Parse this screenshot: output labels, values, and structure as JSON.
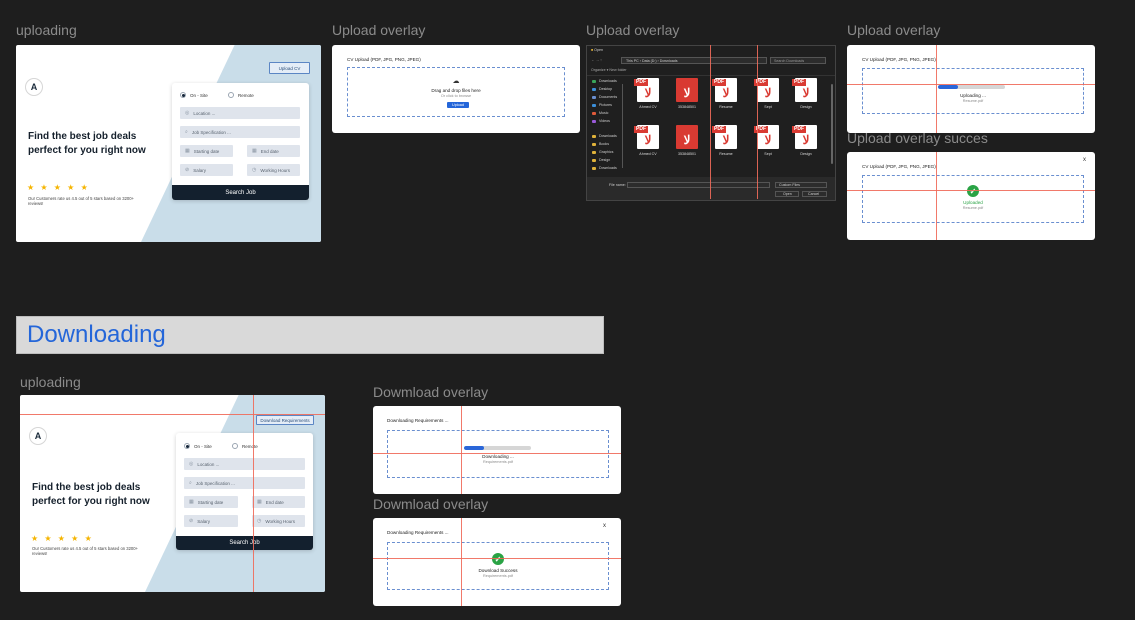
{
  "labels": {
    "uploading_top": "uploading",
    "upload_overlay_1": "Upload overlay",
    "upload_overlay_2": "Upload overlay",
    "upload_overlay_3": "Upload overlay",
    "upload_overlay_success": "Upload overlay succes",
    "uploading_bottom": "uploading",
    "download_overlay_1": "Dowmload overlay",
    "download_overlay_2": "Dowmload overlay"
  },
  "section": {
    "title": "Downloading"
  },
  "landing": {
    "logo": "A",
    "upload_button": "Upload CV",
    "download_button": "Download Requirements",
    "hero_line1": "Find the best job deals",
    "hero_line2": "perfect for you right now",
    "stars": "★ ★ ★ ★ ★",
    "reviews": "Our Customers rate us 4.5 out of 5 stars based on 3200+ reviews!",
    "radio_onsite": "On - Site",
    "radio_remote": "Remote",
    "location": "Location ...",
    "job_spec": "Job Specification ...",
    "starting_date": "Starting date",
    "end_date": "End date",
    "salary": "Salary",
    "working_hours": "Working Hours",
    "search": "Search Job"
  },
  "upload_overlay": {
    "title": "CV Upload (PDF, JPG, PNG, JPEG)",
    "drag": "Drag and drop files here",
    "or": "Or click to browse",
    "button": "Upload",
    "uploading": "Uploading ...",
    "file": "Resume.pdf",
    "progress": 0.3,
    "uploaded": "Uploaded",
    "close": "x"
  },
  "file_dialog": {
    "title": "Open",
    "path": "This PC  ›  Data (D:)  ›  Downloads",
    "search": "Search Downloads",
    "organize": "Organize ▾   New folder",
    "sidebar": [
      "Downloads",
      "Desktop",
      "Documents",
      "Pictures",
      "Music",
      "Videos",
      "Downloads",
      "Books",
      "Graphics",
      "Design",
      "Downloads"
    ],
    "files_row1": [
      "Ahmed CV",
      "353848501",
      "Resume",
      "Sept",
      "Design"
    ],
    "files_row2": [
      "Ahmed CV",
      "353848501",
      "Resume",
      "Sept",
      "Design"
    ],
    "file_name_label": "File name:",
    "filter": "Custom Files",
    "open": "Open",
    "cancel": "Cancel"
  },
  "download_overlay": {
    "title": "Downloading Requirements ...",
    "downloading": "Downloading ...",
    "file": "Requirements.pdf",
    "progress": 0.3,
    "success": "Download Success",
    "close": "x"
  },
  "colors": {
    "accent": "#2466d9",
    "guide": "#f06a5a",
    "success": "#2aa345",
    "navy": "#13202e"
  }
}
